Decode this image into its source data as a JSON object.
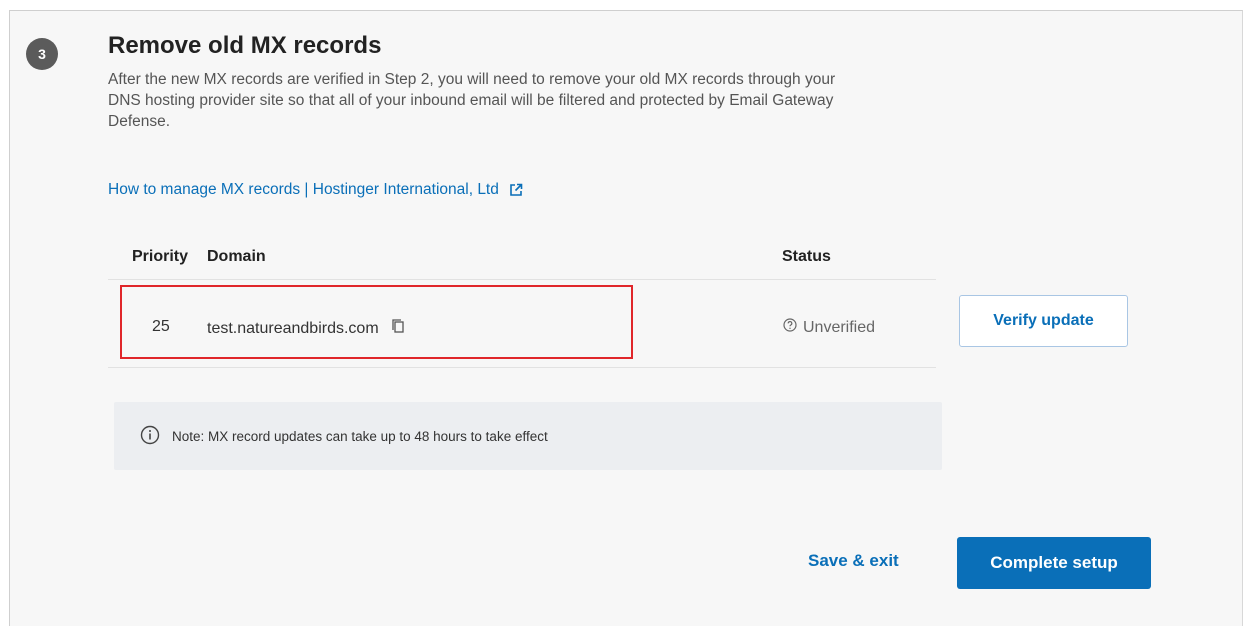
{
  "step": {
    "number": "3",
    "title": "Remove old MX records",
    "description": "After the new MX records are verified in Step 2, you will need to remove your old MX records through your DNS hosting provider site so that all of your inbound email will be filtered and protected by Email Gateway Defense."
  },
  "help_link": {
    "label": "How to manage MX records | Hostinger International, Ltd",
    "icon": "external-link-icon"
  },
  "table": {
    "headers": {
      "priority": "Priority",
      "domain": "Domain",
      "status": "Status"
    },
    "rows": [
      {
        "priority": "25",
        "domain": "test.natureandbirds.com",
        "status": "Unverified",
        "status_icon": "question-circle-icon"
      }
    ]
  },
  "verify_button": "Verify update",
  "note": {
    "icon": "info-icon",
    "text": "Note: MX record updates can take up to 48 hours to take effect"
  },
  "footer": {
    "save_exit": "Save & exit",
    "complete": "Complete setup"
  },
  "colors": {
    "accent": "#0a6fb8",
    "highlight": "#e0262a",
    "badge": "#5b5b5b"
  }
}
